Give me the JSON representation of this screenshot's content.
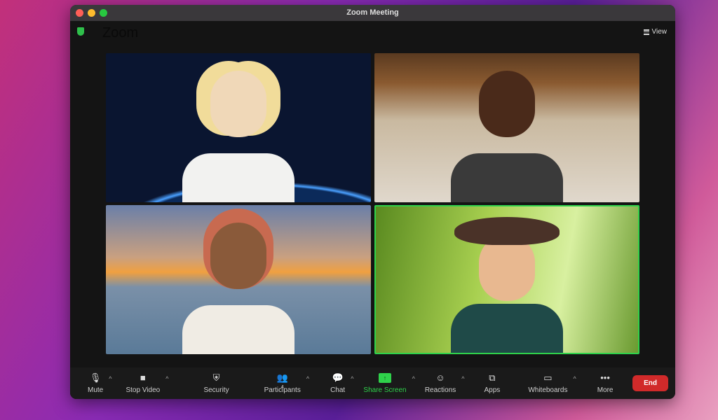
{
  "window": {
    "title": "Zoom Meeting",
    "brand": "Zoom",
    "view_label": "View"
  },
  "toolbar": {
    "mute": "Mute",
    "stop_video": "Stop Video",
    "security": "Security",
    "participants": "Participants",
    "participants_count": "4",
    "chat": "Chat",
    "share_screen": "Share Screen",
    "reactions": "Reactions",
    "apps": "Apps",
    "whiteboards": "Whiteboards",
    "more": "More",
    "end": "End"
  },
  "colors": {
    "share": "#2fd24b",
    "end": "#d12a2a",
    "active_speaker": "#2fd24b"
  }
}
